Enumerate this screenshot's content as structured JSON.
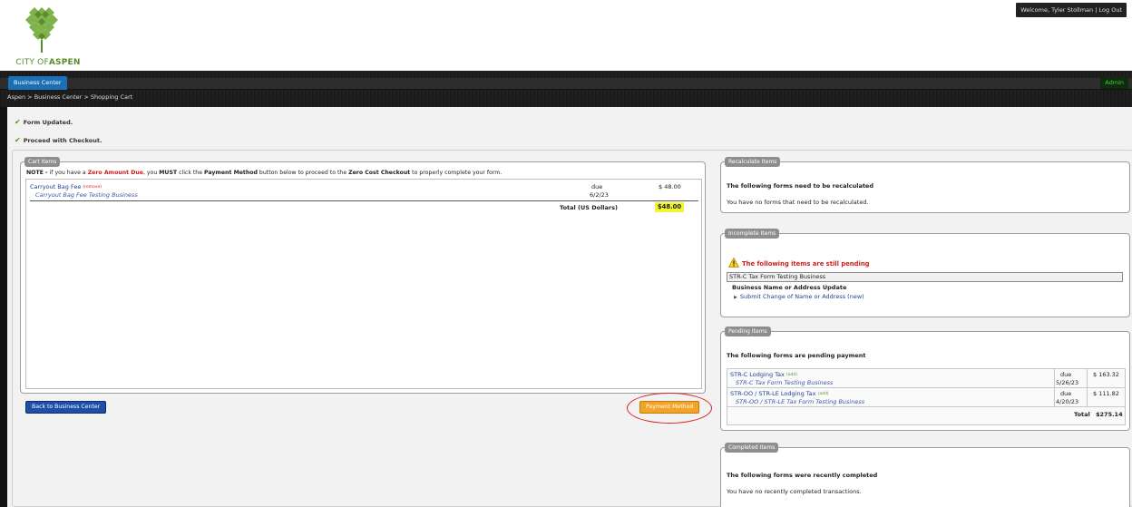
{
  "header": {
    "logo_text_pre": "CITY OF",
    "logo_text_bold": "ASPEN",
    "welcome": "Welcome, Tyler Stollman",
    "separator": "|",
    "logout": "Log Out"
  },
  "nav": {
    "tab_business": "Business Center",
    "tab_admin": "Admin",
    "breadcrumb": [
      "Aspen",
      "Business Center",
      "Shopping Cart"
    ],
    "breadcrumb_sep": ">"
  },
  "messages": {
    "form_updated": "Form Updated.",
    "proceed": "Proceed with Checkout."
  },
  "cart": {
    "legend": "Cart Items",
    "note_prefix": "NOTE -",
    "note_1": " if you have a ",
    "note_zero": "Zero Amount Due",
    "note_2": ", you ",
    "note_must": "MUST",
    "note_3": " click the ",
    "note_pay": "Payment Method",
    "note_4": " button below to proceed to the ",
    "note_zcc": "Zero Cost Checkout",
    "note_5": " to properly complete your form.",
    "item": {
      "name": "Carryout Bag Fee",
      "remove": "(remove)",
      "sub": "Carryout Bag Fee Testing Business",
      "due_label": "due",
      "due_date": "6/2/23",
      "amount": "$ 48.00"
    },
    "total_label": "Total (US Dollars)",
    "total": "$48.00",
    "back_button": "Back to Business Center",
    "pay_button": "Payment Method"
  },
  "recalculate": {
    "legend": "Recalculate Items",
    "title": "The following forms need to be recalculated",
    "text": "You have no forms that need to be recalculated."
  },
  "incomplete": {
    "legend": "Incomplete Items",
    "warning": "The following items are still pending",
    "business": "STR-C Tax Form Testing Business",
    "sub": "Business Name or Address Update",
    "link": "Submit Change of Name or Address (new)"
  },
  "pending": {
    "legend": "Pending Items",
    "title": "The following forms are pending payment",
    "rows": [
      {
        "name": "STR-C Lodging Tax",
        "tag": "(add)",
        "sub": "STR-C Tax Form Testing Business",
        "due": "due",
        "date": "5/26/23",
        "amount": "$ 163.32"
      },
      {
        "name": "STR-OO / STR-LE Lodging Tax",
        "tag": "(add)",
        "sub": "STR-OO / STR-LE Tax Form Testing Business",
        "due": "due",
        "date": "4/20/23",
        "amount": "$ 111.82"
      }
    ],
    "total_label": "Total",
    "total": "$275.14"
  },
  "completed": {
    "legend": "Completed Items",
    "title": "The following forms were recently completed",
    "text": "You have no recently completed transactions."
  },
  "colors": {
    "accent_blue": "#1b6fb4",
    "pay_orange": "#f3a326",
    "highlight_yellow": "#f1f532",
    "error_red": "#d21b1b",
    "admin_green": "#4ccf3c"
  }
}
